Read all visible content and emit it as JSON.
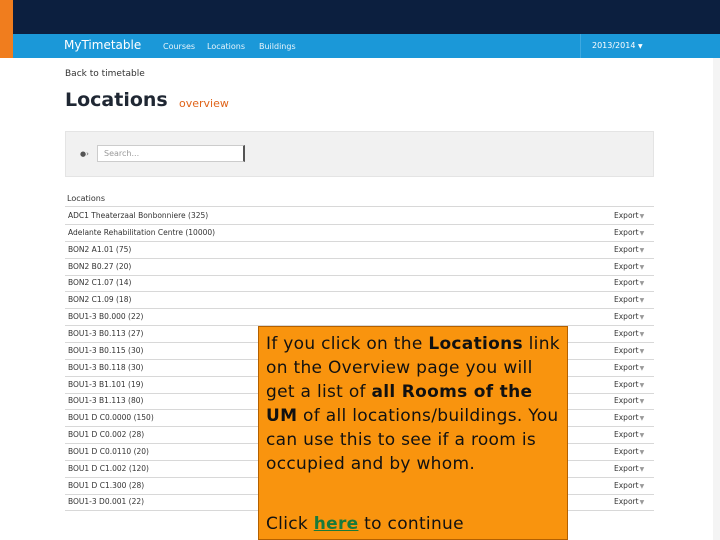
{
  "navbar": {
    "brand": "MyTimetable",
    "links": [
      "Courses",
      "Locations",
      "Buildings"
    ],
    "year": "2013/2014"
  },
  "page": {
    "back_link": "Back to timetable",
    "title": "Locations",
    "subtitle": "overview",
    "search_placeholder": "Search...",
    "list_header": "Locations",
    "export_label": "Export"
  },
  "rows": [
    "ADC1 Theaterzaal Bonbonniere (325)",
    "Adelante Rehabilitation Centre (10000)",
    "BON2 A1.01 (75)",
    "BON2 B0.27 (20)",
    "BON2 C1.07 (14)",
    "BON2 C1.09 (18)",
    "BOU1-3 B0.000 (22)",
    "BOU1-3 B0.113 (27)",
    "BOU1-3 B0.115 (30)",
    "BOU1-3 B0.118 (30)",
    "BOU1-3 B1.101 (19)",
    "BOU1-3 B1.113 (80)",
    "BOU1 D C0.0000 (150)",
    "BOU1 D C0.002 (28)",
    "BOU1 D C0.0110 (20)",
    "BOU1 D C1.002 (120)",
    "BOU1 D C1.300 (28)",
    "BOU1-3 D0.001 (22)"
  ],
  "callout": {
    "p1": "If you click on the ",
    "b1": "Locations",
    "p2": " link on the Overview page you will get a list of ",
    "b2": "all Rooms of the UM",
    "p3": " of all locations/buildings. You can use this to see if a room is occupied and by whom.",
    "continue_pre": "Click ",
    "continue_link": "here",
    "continue_post": " to continue"
  }
}
